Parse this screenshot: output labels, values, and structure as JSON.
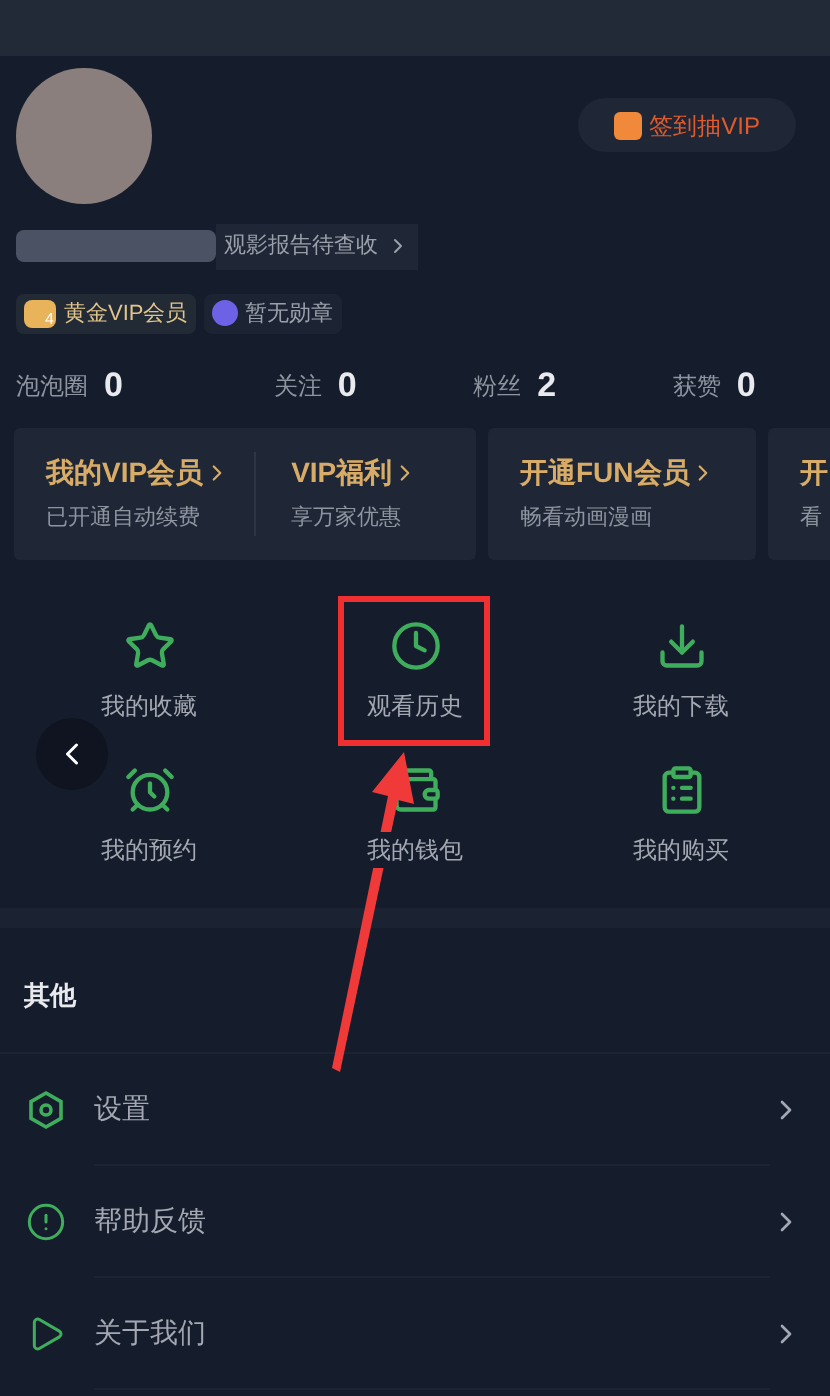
{
  "profile": {
    "checkin_button": "签到抽VIP",
    "report_link": "观影报告待查收",
    "badges": [
      {
        "kind": "vip",
        "label": "黄金VIP会员",
        "level_text": "4"
      },
      {
        "kind": "medal",
        "label": "暂无勋章"
      }
    ]
  },
  "stats": [
    {
      "label": "泡泡圈",
      "value": "0"
    },
    {
      "label": "关注",
      "value": "0"
    },
    {
      "label": "粉丝",
      "value": "2"
    },
    {
      "label": "获赞",
      "value": "0"
    }
  ],
  "vip_cards": [
    {
      "items": [
        {
          "title": "我的VIP会员",
          "subtitle": "已开通自动续费"
        },
        {
          "title": "VIP福利",
          "subtitle": "享万家优惠"
        }
      ]
    },
    {
      "items": [
        {
          "title": "开通FUN会员",
          "subtitle": "畅看动画漫画"
        }
      ]
    },
    {
      "items": [
        {
          "title": "开",
          "subtitle": "看"
        }
      ]
    }
  ],
  "shortcuts": [
    {
      "kind": "favorites",
      "label": "我的收藏",
      "highlighted": false
    },
    {
      "kind": "history",
      "label": "观看历史",
      "highlighted": true
    },
    {
      "kind": "downloads",
      "label": "我的下载",
      "highlighted": false
    },
    {
      "kind": "reservations",
      "label": "我的预约",
      "highlighted": false
    },
    {
      "kind": "wallet",
      "label": "我的钱包",
      "highlighted": false
    },
    {
      "kind": "purchases",
      "label": "我的购买",
      "highlighted": false
    }
  ],
  "other": {
    "title": "其他",
    "items": [
      {
        "kind": "settings",
        "label": "设置"
      },
      {
        "kind": "feedback",
        "label": "帮助反馈"
      },
      {
        "kind": "about",
        "label": "关于我们"
      }
    ]
  }
}
